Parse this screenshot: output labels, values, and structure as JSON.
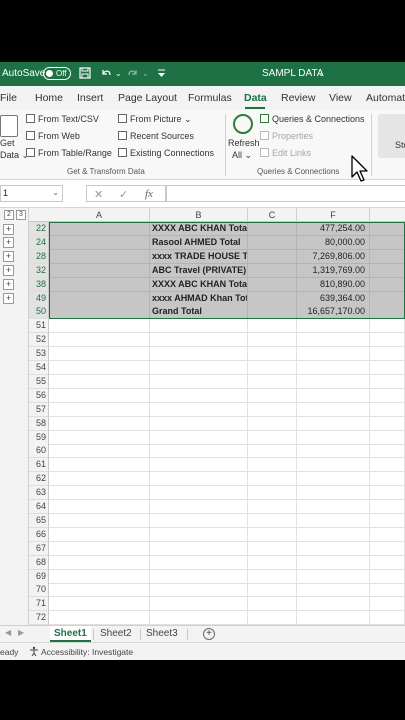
{
  "titlebar": {
    "autosave_label": "AutoSave",
    "toggle_state": "Off",
    "document_title": "SAMPL DATA",
    "chevron": "⌄"
  },
  "tabs": [
    "File",
    "Home",
    "Insert",
    "Page Layout",
    "Formulas",
    "Data",
    "Review",
    "View",
    "Automat"
  ],
  "active_tab": "Data",
  "ribbon": {
    "get_data": [
      "Get",
      "Data ⌄"
    ],
    "get_transform": {
      "items": [
        "From Text/CSV",
        "From Web",
        "From Table/Range",
        "From Picture ⌄",
        "Recent Sources",
        "Existing Connections"
      ],
      "group_label": "Get & Transform Data"
    },
    "queries": {
      "refresh_all": [
        "Refresh",
        "All ⌄"
      ],
      "items": [
        "Queries & Connections",
        "Properties",
        "Edit Links"
      ],
      "group_label": "Queries & Connections"
    },
    "stocks_partial": "Sto"
  },
  "formula_bar": {
    "name_box": "1",
    "name_box_chevron": "⌄",
    "cancel": "✕",
    "enter": "✓",
    "fx": "fx",
    "formula": ""
  },
  "grid": {
    "outline_levels": [
      "2",
      "3"
    ],
    "columns": [
      "A",
      "B",
      "C",
      "F"
    ],
    "rows": [
      {
        "num": "22",
        "label": "XXXX ABC KHAN Total",
        "value": "477,254.00",
        "plus": true
      },
      {
        "num": "24",
        "label": "Rasool AHMED Total",
        "value": "80,000.00",
        "plus": true
      },
      {
        "num": "28",
        "label": "xxxx TRADE HOUSE Total",
        "value": "7,269,806.00",
        "plus": true
      },
      {
        "num": "32",
        "label": "ABC Travel (PRIVATE)  Total",
        "value": "1,319,769.00",
        "plus": true
      },
      {
        "num": "38",
        "label": "XXXX ABC KHAN Total",
        "value": "810,890.00",
        "plus": true
      },
      {
        "num": "49",
        "label": "xxxx AHMAD Khan Total",
        "value": "639,364.00",
        "plus": true
      },
      {
        "num": "50",
        "label": "Grand Total",
        "value": "16,657,170.00",
        "plus": false
      }
    ],
    "empty_rows": [
      "51",
      "52",
      "53",
      "54",
      "55",
      "56",
      "57",
      "58",
      "59",
      "60",
      "61",
      "62",
      "63",
      "64",
      "65",
      "66",
      "67",
      "68",
      "69",
      "70",
      "71",
      "72"
    ]
  },
  "sheets": [
    "Sheet1",
    "Sheet2",
    "Sheet3"
  ],
  "active_sheet": "Sheet1",
  "status": {
    "ready": "eady",
    "accessibility": "Accessibility: Investigate"
  }
}
